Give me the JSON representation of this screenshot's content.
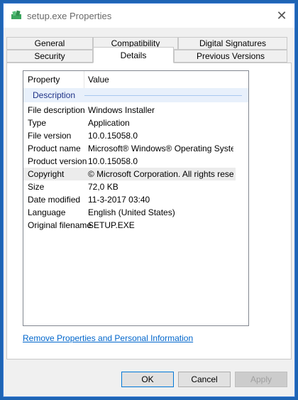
{
  "window": {
    "title": "setup.exe Properties",
    "close_glyph": "✕"
  },
  "tabs": {
    "row1": [
      {
        "label": "General"
      },
      {
        "label": "Compatibility"
      },
      {
        "label": "Digital Signatures"
      }
    ],
    "row2": [
      {
        "label": "Security"
      },
      {
        "label": "Details",
        "active": true
      },
      {
        "label": "Previous Versions"
      }
    ]
  },
  "details": {
    "columns": {
      "property": "Property",
      "value": "Value"
    },
    "group": "Description",
    "rows": [
      {
        "property": "File description",
        "value": "Windows Installer"
      },
      {
        "property": "Type",
        "value": "Application"
      },
      {
        "property": "File version",
        "value": "10.0.15058.0"
      },
      {
        "property": "Product name",
        "value": "Microsoft® Windows® Operating System"
      },
      {
        "property": "Product version",
        "value": "10.0.15058.0"
      },
      {
        "property": "Copyright",
        "value": "© Microsoft Corporation. All rights reserv..."
      },
      {
        "property": "Size",
        "value": "72,0 KB"
      },
      {
        "property": "Date modified",
        "value": "11-3-2017 03:40"
      },
      {
        "property": "Language",
        "value": "English (United States)"
      },
      {
        "property": "Original filename",
        "value": "SETUP.EXE"
      }
    ]
  },
  "link": {
    "remove": "Remove Properties and Personal Information"
  },
  "buttons": {
    "ok": "OK",
    "cancel": "Cancel",
    "apply": "Apply"
  },
  "colors": {
    "accent": "#0078d7",
    "link": "#0066cc",
    "group_text": "#1e3287",
    "desktop": "#1e64b4"
  }
}
